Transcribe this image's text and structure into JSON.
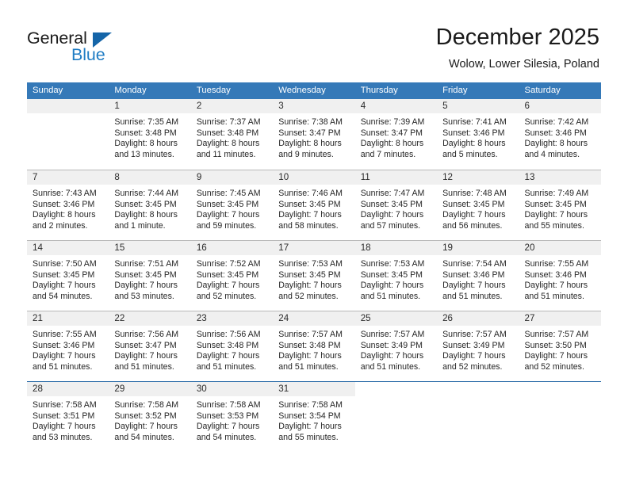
{
  "logo": {
    "word_top": "General",
    "word_bottom": "Blue",
    "triangle_color": "#1565a8",
    "blue_text_color": "#1f7cc4"
  },
  "header": {
    "title": "December 2025",
    "subtitle": "Wolow, Lower Silesia, Poland"
  },
  "theme": {
    "header_row_bg": "#3579b8",
    "header_row_text": "#ffffff",
    "daynum_bg": "#f0f0f0",
    "grid_line": "#b8b8b8",
    "last_row_line": "#2b6ca8"
  },
  "calendar": {
    "weekday_headers": [
      "Sunday",
      "Monday",
      "Tuesday",
      "Wednesday",
      "Thursday",
      "Friday",
      "Saturday"
    ],
    "weeks": [
      [
        {
          "day": "",
          "lines": []
        },
        {
          "day": "1",
          "lines": [
            "Sunrise: 7:35 AM",
            "Sunset: 3:48 PM",
            "Daylight: 8 hours",
            "and 13 minutes."
          ]
        },
        {
          "day": "2",
          "lines": [
            "Sunrise: 7:37 AM",
            "Sunset: 3:48 PM",
            "Daylight: 8 hours",
            "and 11 minutes."
          ]
        },
        {
          "day": "3",
          "lines": [
            "Sunrise: 7:38 AM",
            "Sunset: 3:47 PM",
            "Daylight: 8 hours",
            "and 9 minutes."
          ]
        },
        {
          "day": "4",
          "lines": [
            "Sunrise: 7:39 AM",
            "Sunset: 3:47 PM",
            "Daylight: 8 hours",
            "and 7 minutes."
          ]
        },
        {
          "day": "5",
          "lines": [
            "Sunrise: 7:41 AM",
            "Sunset: 3:46 PM",
            "Daylight: 8 hours",
            "and 5 minutes."
          ]
        },
        {
          "day": "6",
          "lines": [
            "Sunrise: 7:42 AM",
            "Sunset: 3:46 PM",
            "Daylight: 8 hours",
            "and 4 minutes."
          ]
        }
      ],
      [
        {
          "day": "7",
          "lines": [
            "Sunrise: 7:43 AM",
            "Sunset: 3:46 PM",
            "Daylight: 8 hours",
            "and 2 minutes."
          ]
        },
        {
          "day": "8",
          "lines": [
            "Sunrise: 7:44 AM",
            "Sunset: 3:45 PM",
            "Daylight: 8 hours",
            "and 1 minute."
          ]
        },
        {
          "day": "9",
          "lines": [
            "Sunrise: 7:45 AM",
            "Sunset: 3:45 PM",
            "Daylight: 7 hours",
            "and 59 minutes."
          ]
        },
        {
          "day": "10",
          "lines": [
            "Sunrise: 7:46 AM",
            "Sunset: 3:45 PM",
            "Daylight: 7 hours",
            "and 58 minutes."
          ]
        },
        {
          "day": "11",
          "lines": [
            "Sunrise: 7:47 AM",
            "Sunset: 3:45 PM",
            "Daylight: 7 hours",
            "and 57 minutes."
          ]
        },
        {
          "day": "12",
          "lines": [
            "Sunrise: 7:48 AM",
            "Sunset: 3:45 PM",
            "Daylight: 7 hours",
            "and 56 minutes."
          ]
        },
        {
          "day": "13",
          "lines": [
            "Sunrise: 7:49 AM",
            "Sunset: 3:45 PM",
            "Daylight: 7 hours",
            "and 55 minutes."
          ]
        }
      ],
      [
        {
          "day": "14",
          "lines": [
            "Sunrise: 7:50 AM",
            "Sunset: 3:45 PM",
            "Daylight: 7 hours",
            "and 54 minutes."
          ]
        },
        {
          "day": "15",
          "lines": [
            "Sunrise: 7:51 AM",
            "Sunset: 3:45 PM",
            "Daylight: 7 hours",
            "and 53 minutes."
          ]
        },
        {
          "day": "16",
          "lines": [
            "Sunrise: 7:52 AM",
            "Sunset: 3:45 PM",
            "Daylight: 7 hours",
            "and 52 minutes."
          ]
        },
        {
          "day": "17",
          "lines": [
            "Sunrise: 7:53 AM",
            "Sunset: 3:45 PM",
            "Daylight: 7 hours",
            "and 52 minutes."
          ]
        },
        {
          "day": "18",
          "lines": [
            "Sunrise: 7:53 AM",
            "Sunset: 3:45 PM",
            "Daylight: 7 hours",
            "and 51 minutes."
          ]
        },
        {
          "day": "19",
          "lines": [
            "Sunrise: 7:54 AM",
            "Sunset: 3:46 PM",
            "Daylight: 7 hours",
            "and 51 minutes."
          ]
        },
        {
          "day": "20",
          "lines": [
            "Sunrise: 7:55 AM",
            "Sunset: 3:46 PM",
            "Daylight: 7 hours",
            "and 51 minutes."
          ]
        }
      ],
      [
        {
          "day": "21",
          "lines": [
            "Sunrise: 7:55 AM",
            "Sunset: 3:46 PM",
            "Daylight: 7 hours",
            "and 51 minutes."
          ]
        },
        {
          "day": "22",
          "lines": [
            "Sunrise: 7:56 AM",
            "Sunset: 3:47 PM",
            "Daylight: 7 hours",
            "and 51 minutes."
          ]
        },
        {
          "day": "23",
          "lines": [
            "Sunrise: 7:56 AM",
            "Sunset: 3:48 PM",
            "Daylight: 7 hours",
            "and 51 minutes."
          ]
        },
        {
          "day": "24",
          "lines": [
            "Sunrise: 7:57 AM",
            "Sunset: 3:48 PM",
            "Daylight: 7 hours",
            "and 51 minutes."
          ]
        },
        {
          "day": "25",
          "lines": [
            "Sunrise: 7:57 AM",
            "Sunset: 3:49 PM",
            "Daylight: 7 hours",
            "and 51 minutes."
          ]
        },
        {
          "day": "26",
          "lines": [
            "Sunrise: 7:57 AM",
            "Sunset: 3:49 PM",
            "Daylight: 7 hours",
            "and 52 minutes."
          ]
        },
        {
          "day": "27",
          "lines": [
            "Sunrise: 7:57 AM",
            "Sunset: 3:50 PM",
            "Daylight: 7 hours",
            "and 52 minutes."
          ]
        }
      ],
      [
        {
          "day": "28",
          "lines": [
            "Sunrise: 7:58 AM",
            "Sunset: 3:51 PM",
            "Daylight: 7 hours",
            "and 53 minutes."
          ]
        },
        {
          "day": "29",
          "lines": [
            "Sunrise: 7:58 AM",
            "Sunset: 3:52 PM",
            "Daylight: 7 hours",
            "and 54 minutes."
          ]
        },
        {
          "day": "30",
          "lines": [
            "Sunrise: 7:58 AM",
            "Sunset: 3:53 PM",
            "Daylight: 7 hours",
            "and 54 minutes."
          ]
        },
        {
          "day": "31",
          "lines": [
            "Sunrise: 7:58 AM",
            "Sunset: 3:54 PM",
            "Daylight: 7 hours",
            "and 55 minutes."
          ]
        },
        {
          "day": "",
          "lines": []
        },
        {
          "day": "",
          "lines": []
        },
        {
          "day": "",
          "lines": []
        }
      ]
    ]
  }
}
